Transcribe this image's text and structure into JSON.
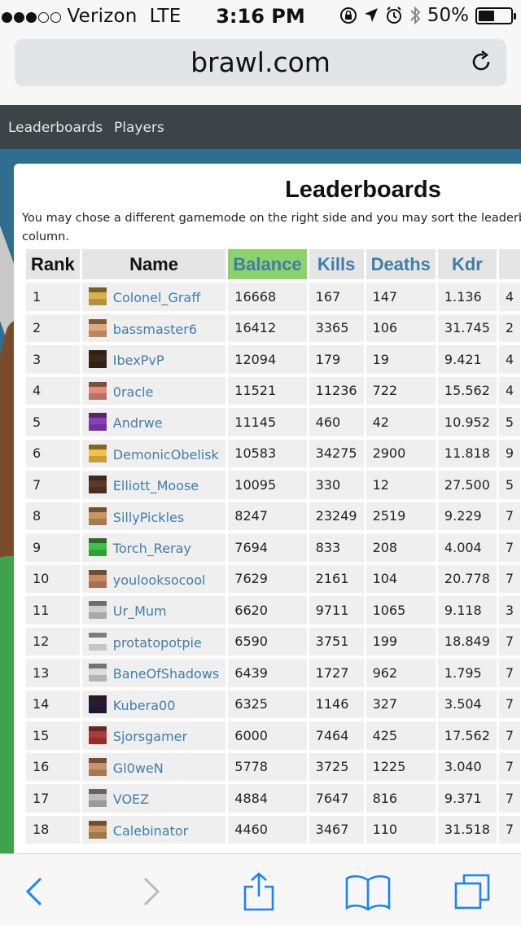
{
  "status_bar": {
    "carrier": "Verizon",
    "network": "LTE",
    "time": "3:16 PM",
    "battery": "50%",
    "battery_level": 0.5,
    "signal_bars": 3,
    "signal_total": 5
  },
  "browser": {
    "url": "brawl.com"
  },
  "site_nav": {
    "items": [
      {
        "label": "Leaderboards"
      },
      {
        "label": "Players"
      }
    ]
  },
  "page": {
    "title": "Leaderboards",
    "intro_line1": "You may chose a different gamemode on the right side and you may sort the leaderboar",
    "intro_line2": "column."
  },
  "table": {
    "headers": {
      "rank": "Rank",
      "name": "Name",
      "balance": "Balance",
      "kills": "Kills",
      "deaths": "Deaths",
      "kdr": "Kdr"
    },
    "rows": [
      {
        "rank": "1",
        "name": "Colonel_Graff",
        "balance": "16668",
        "kills": "167",
        "deaths": "147",
        "kdr": "1.136",
        "extra": "4",
        "skin": "#d9b24a"
      },
      {
        "rank": "2",
        "name": "bassmaster6",
        "balance": "16412",
        "kills": "3365",
        "deaths": "106",
        "kdr": "31.745",
        "extra": "2",
        "skin": "#e0a878"
      },
      {
        "rank": "3",
        "name": "IbexPvP",
        "balance": "12094",
        "kills": "179",
        "deaths": "19",
        "kdr": "9.421",
        "extra": "4",
        "skin": "#3a2a1a"
      },
      {
        "rank": "4",
        "name": "0racle",
        "balance": "11521",
        "kills": "11236",
        "deaths": "722",
        "kdr": "15.562",
        "extra": "4",
        "skin": "#e38c7a"
      },
      {
        "rank": "5",
        "name": "Andrwe",
        "balance": "11145",
        "kills": "460",
        "deaths": "42",
        "kdr": "10.952",
        "extra": "5",
        "skin": "#8a3fbf"
      },
      {
        "rank": "6",
        "name": "DemonicObelisk",
        "balance": "10583",
        "kills": "34275",
        "deaths": "2900",
        "kdr": "11.818",
        "extra": "9",
        "skin": "#f0c24a"
      },
      {
        "rank": "7",
        "name": "Elliott_Moose",
        "balance": "10095",
        "kills": "330",
        "deaths": "12",
        "kdr": "27.500",
        "extra": "5",
        "skin": "#5a3a28"
      },
      {
        "rank": "8",
        "name": "SillyPickles",
        "balance": "8247",
        "kills": "23249",
        "deaths": "2519",
        "kdr": "9.229",
        "extra": "7",
        "skin": "#c99660"
      },
      {
        "rank": "9",
        "name": "Torch_Reray",
        "balance": "7694",
        "kills": "833",
        "deaths": "208",
        "kdr": "4.004",
        "extra": "7",
        "skin": "#3ec24a"
      },
      {
        "rank": "10",
        "name": "youlooksocool",
        "balance": "7629",
        "kills": "2161",
        "deaths": "104",
        "kdr": "20.778",
        "extra": "7",
        "skin": "#c98a62"
      },
      {
        "rank": "11",
        "name": "Ur_Mum",
        "balance": "6620",
        "kills": "9711",
        "deaths": "1065",
        "kdr": "9.118",
        "extra": "3",
        "skin": "#cfcfcf"
      },
      {
        "rank": "12",
        "name": "protatopotpie",
        "balance": "6590",
        "kills": "3751",
        "deaths": "199",
        "kdr": "18.849",
        "extra": "7",
        "skin": "#f2f2f2"
      },
      {
        "rank": "13",
        "name": "BaneOfShadows",
        "balance": "6439",
        "kills": "1727",
        "deaths": "962",
        "kdr": "1.795",
        "extra": "7",
        "skin": "#dcdcdc"
      },
      {
        "rank": "14",
        "name": "Kubera00",
        "balance": "6325",
        "kills": "1146",
        "deaths": "327",
        "kdr": "3.504",
        "extra": "7",
        "skin": "#2a1a3a"
      },
      {
        "rank": "15",
        "name": "Sjorsgamer",
        "balance": "6000",
        "kills": "7464",
        "deaths": "425",
        "kdr": "17.562",
        "extra": "7",
        "skin": "#b03a3a"
      },
      {
        "rank": "16",
        "name": "Gl0weN",
        "balance": "5778",
        "kills": "3725",
        "deaths": "1225",
        "kdr": "3.040",
        "extra": "7",
        "skin": "#c9946a"
      },
      {
        "rank": "17",
        "name": "VOEZ",
        "balance": "4884",
        "kills": "7647",
        "deaths": "816",
        "kdr": "9.371",
        "extra": "7",
        "skin": "#bdbdbd"
      },
      {
        "rank": "18",
        "name": "Calebinator",
        "balance": "4460",
        "kills": "3467",
        "deaths": "110",
        "kdr": "31.518",
        "extra": "7",
        "skin": "#c49260"
      }
    ]
  },
  "colors": {
    "link": "#3f7ea8",
    "active_header": "#8cd26b",
    "nav_bg": "#3d4346",
    "ios_blue": "#1a82fb"
  }
}
